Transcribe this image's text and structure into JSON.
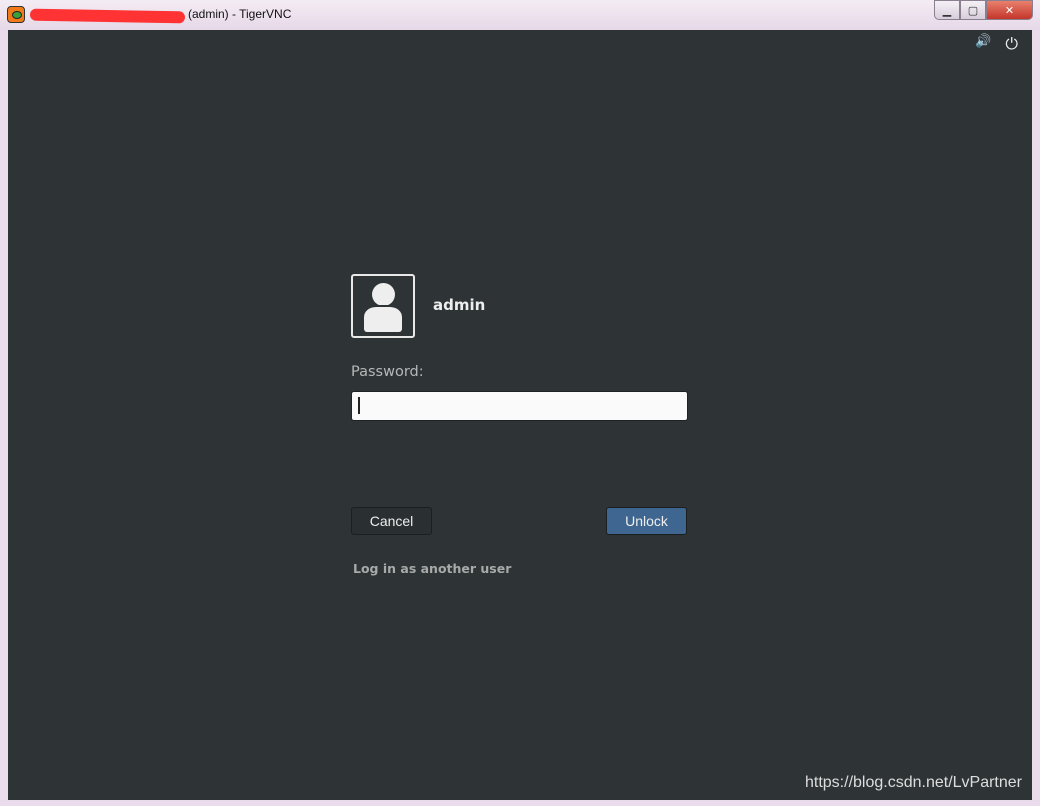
{
  "window": {
    "title": "(admin) - TigerVNC",
    "minimize": "▭",
    "maximize": "▢",
    "close": "✕"
  },
  "tray": {
    "volume_icon": "🔊",
    "power_icon": "⏻"
  },
  "login": {
    "username": "admin",
    "password_label": "Password:",
    "password_value": "",
    "cancel_label": "Cancel",
    "unlock_label": "Unlock",
    "other_user_label": "Log in as another user",
    "accent": "#3e6690"
  },
  "watermark": "https://blog.csdn.net/LvPartner"
}
